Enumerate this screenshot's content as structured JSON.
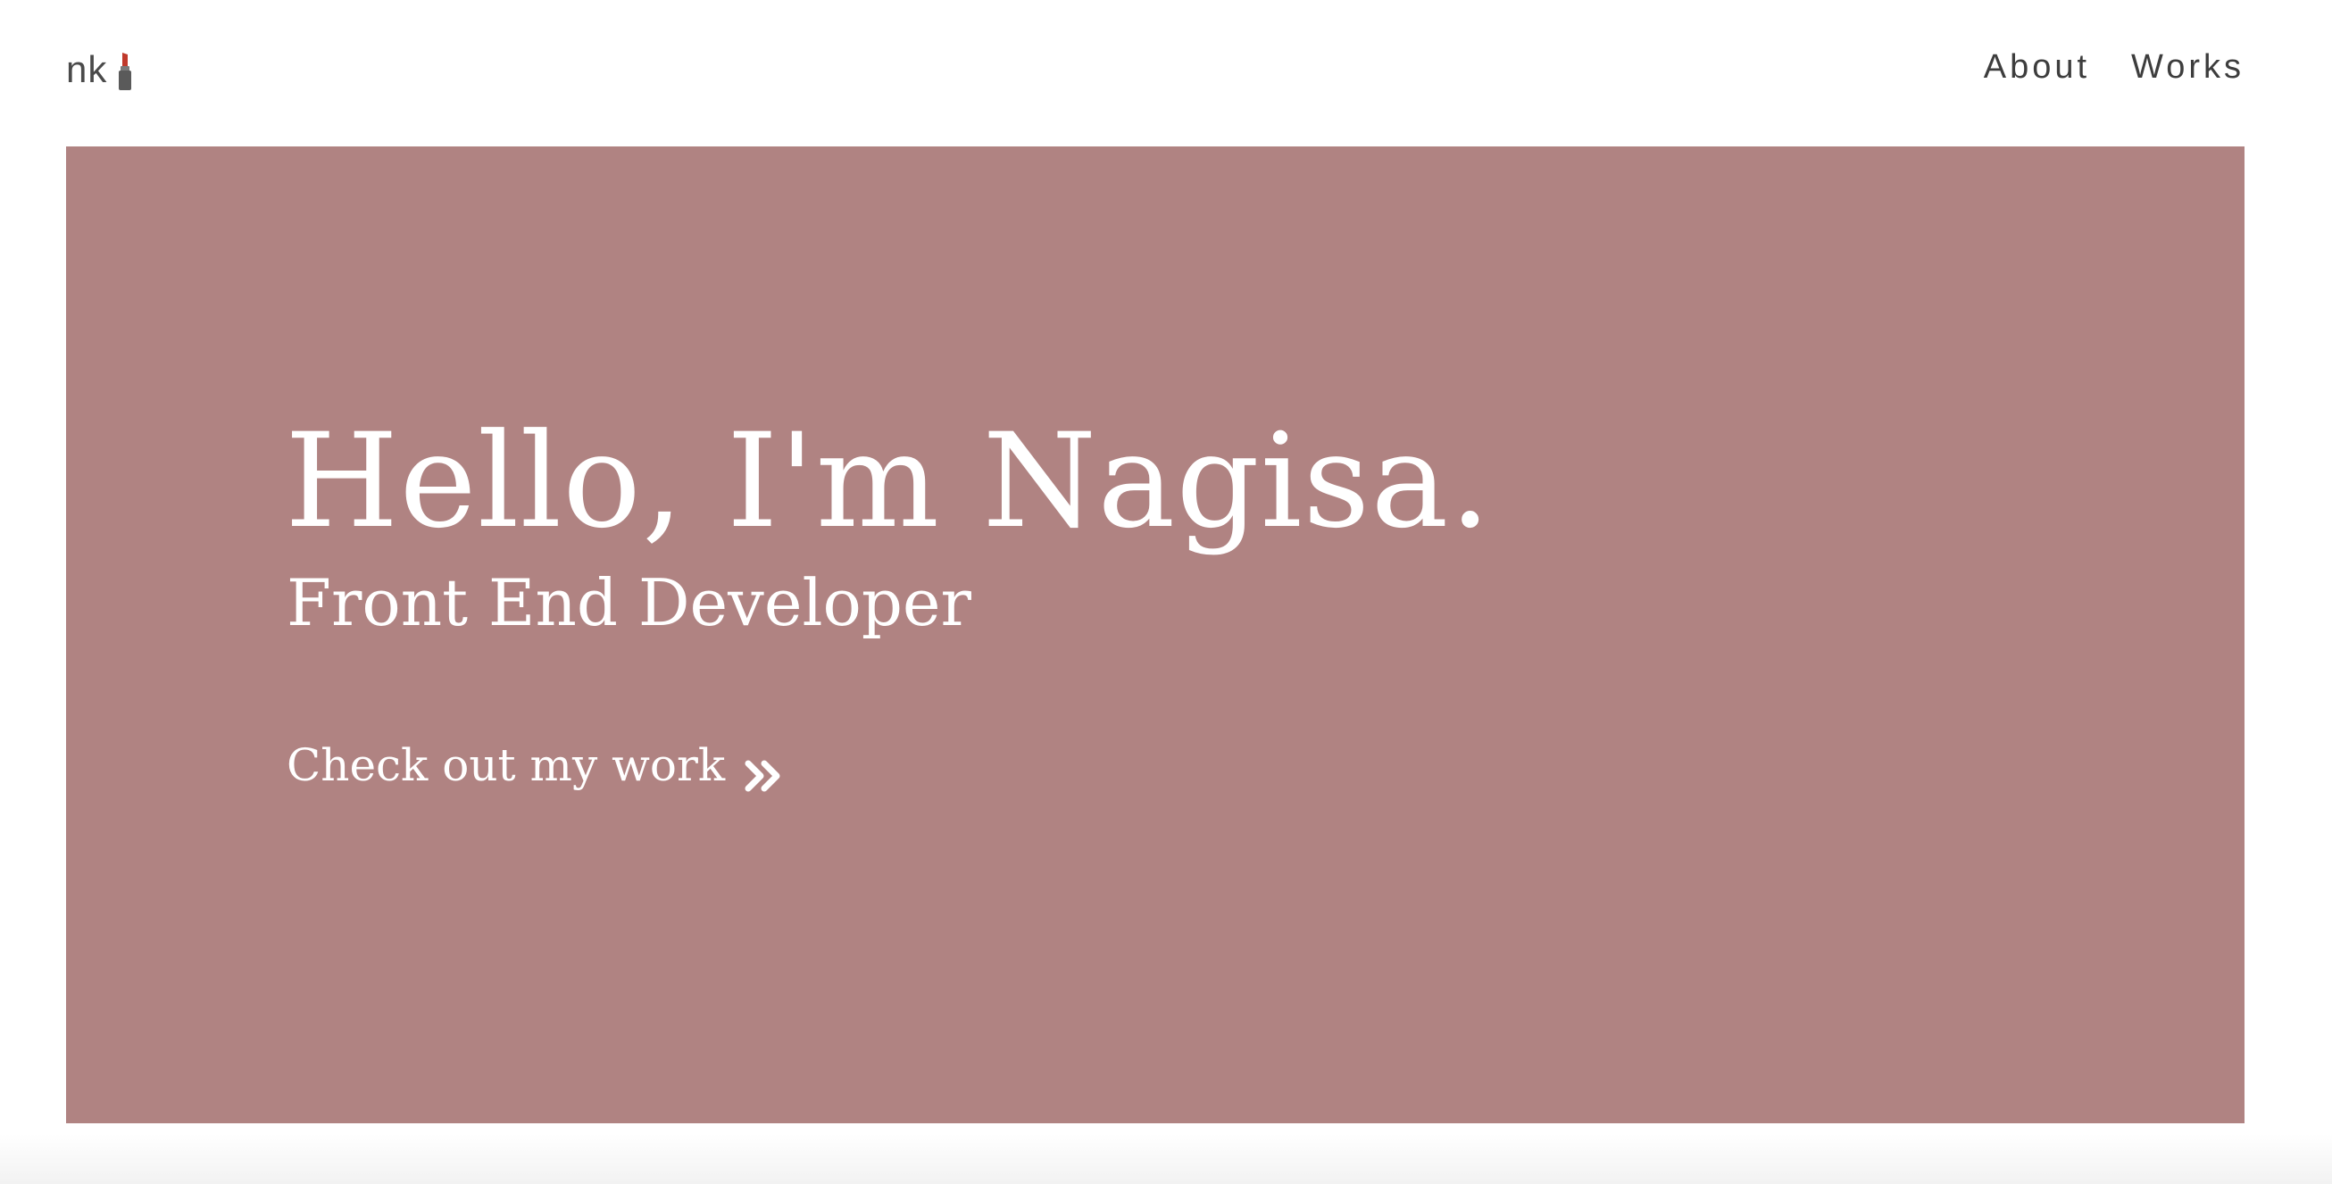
{
  "header": {
    "logo_text": "nk",
    "logo_icon": "lipstick-icon",
    "nav": [
      {
        "label": "About"
      },
      {
        "label": "Works"
      }
    ]
  },
  "hero": {
    "title": "Hello, I'm Nagisa.",
    "subtitle": "Front End Developer",
    "cta_label": "Check out my work",
    "cta_icon": "double-chevron-right-icon",
    "background_color": "#b08382",
    "text_color": "#ffffff"
  },
  "colors": {
    "page_background": "#ffffff",
    "nav_text": "#3d3d3d",
    "lipstick_red": "#c0392b",
    "lipstick_case": "#5a5a5a"
  }
}
